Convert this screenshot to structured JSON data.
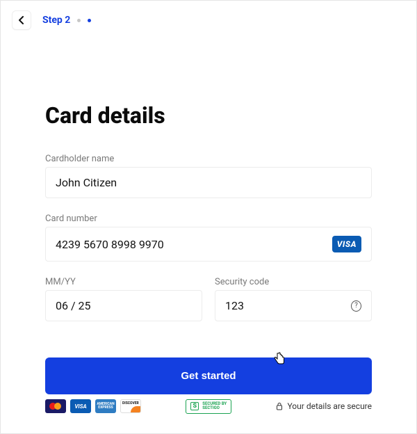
{
  "step": {
    "label": "Step 2"
  },
  "title": "Card details",
  "fields": {
    "cardholder": {
      "label": "Cardholder name",
      "value": "John Citizen"
    },
    "cardnumber": {
      "label": "Card number",
      "value": "4239 5670 8998 9970",
      "brand": "VISA"
    },
    "expiry": {
      "label": "MM/YY",
      "value": "06 / 25"
    },
    "cvc": {
      "label": "Security code",
      "value": "123"
    }
  },
  "cta": "Get started",
  "footer": {
    "sectigo_line1": "SECURED BY",
    "sectigo_line2": "SECTIGO",
    "secure_text": "Your details are secure",
    "brands": {
      "visa": "VISA",
      "amex": "AMERICAN\nEXPRESS",
      "discover": "DISCOVER"
    }
  }
}
